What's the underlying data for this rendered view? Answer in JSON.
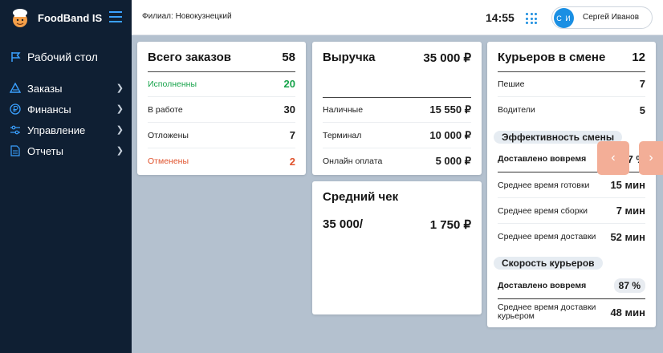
{
  "sidebar": {
    "brand": "FoodBand IS",
    "items": [
      {
        "label": "Рабочий стол",
        "icon": "flag-icon"
      },
      {
        "label": "Заказы",
        "icon": "chef-hat-icon"
      },
      {
        "label": "Финансы",
        "icon": "ruble-icon"
      },
      {
        "label": "Управление",
        "icon": "sliders-icon"
      },
      {
        "label": "Отчеты",
        "icon": "document-icon"
      }
    ]
  },
  "header": {
    "branch": "Филиал: Новокузнецкий",
    "time": "14:55",
    "user_initials": "С И",
    "user_name": "Сергей Иванов"
  },
  "orders": {
    "title": "Всего заказов",
    "total": "58",
    "rows": [
      {
        "label": "Исполненны",
        "value": "20",
        "status": "green"
      },
      {
        "label": "В работе",
        "value": "30",
        "status": "normal"
      },
      {
        "label": "Отложены",
        "value": "7",
        "status": "normal"
      },
      {
        "label": "Отменены",
        "value": "2",
        "status": "red"
      }
    ]
  },
  "revenue": {
    "title": "Выручка",
    "total": "35 000 ₽",
    "rows": [
      {
        "label": "Наличные",
        "value": "15 550 ₽"
      },
      {
        "label": "Терминал",
        "value": "10 000 ₽"
      },
      {
        "label": "Онлайн оплата",
        "value": "5 000 ₽"
      }
    ]
  },
  "avg_check": {
    "title": "Средний чек",
    "left": "35 000/",
    "right": "1 750 ₽"
  },
  "couriers": {
    "title": "Курьеров в смене",
    "total": "12",
    "rows": [
      {
        "label": "Пешие",
        "value": "7"
      },
      {
        "label": "Водители",
        "value": "5"
      }
    ],
    "efficiency_title": "Эффективность смены",
    "efficiency_rows": [
      {
        "label": "Доставлено вовремя",
        "value": "87 %"
      },
      {
        "label": "Среднее время готовки",
        "value": "15 мин"
      },
      {
        "label": "Среднее время сборки",
        "value": "7 мин"
      },
      {
        "label": "Среднее время доставки",
        "value": "52 мин"
      }
    ],
    "speed_title": "Скорость курьеров",
    "speed_rows": [
      {
        "label": "Доставлено вовремя",
        "value": "87 %"
      },
      {
        "label": "Среднее время доставки курьером",
        "value": "48 мин"
      }
    ]
  },
  "carousel": {
    "prev": "‹",
    "next": "›"
  },
  "colors": {
    "sidebar": "#0f1f33",
    "accent": "#1a8fe3",
    "success": "#16a34a",
    "danger": "#e0522c",
    "carousel": "#f3ae97"
  }
}
